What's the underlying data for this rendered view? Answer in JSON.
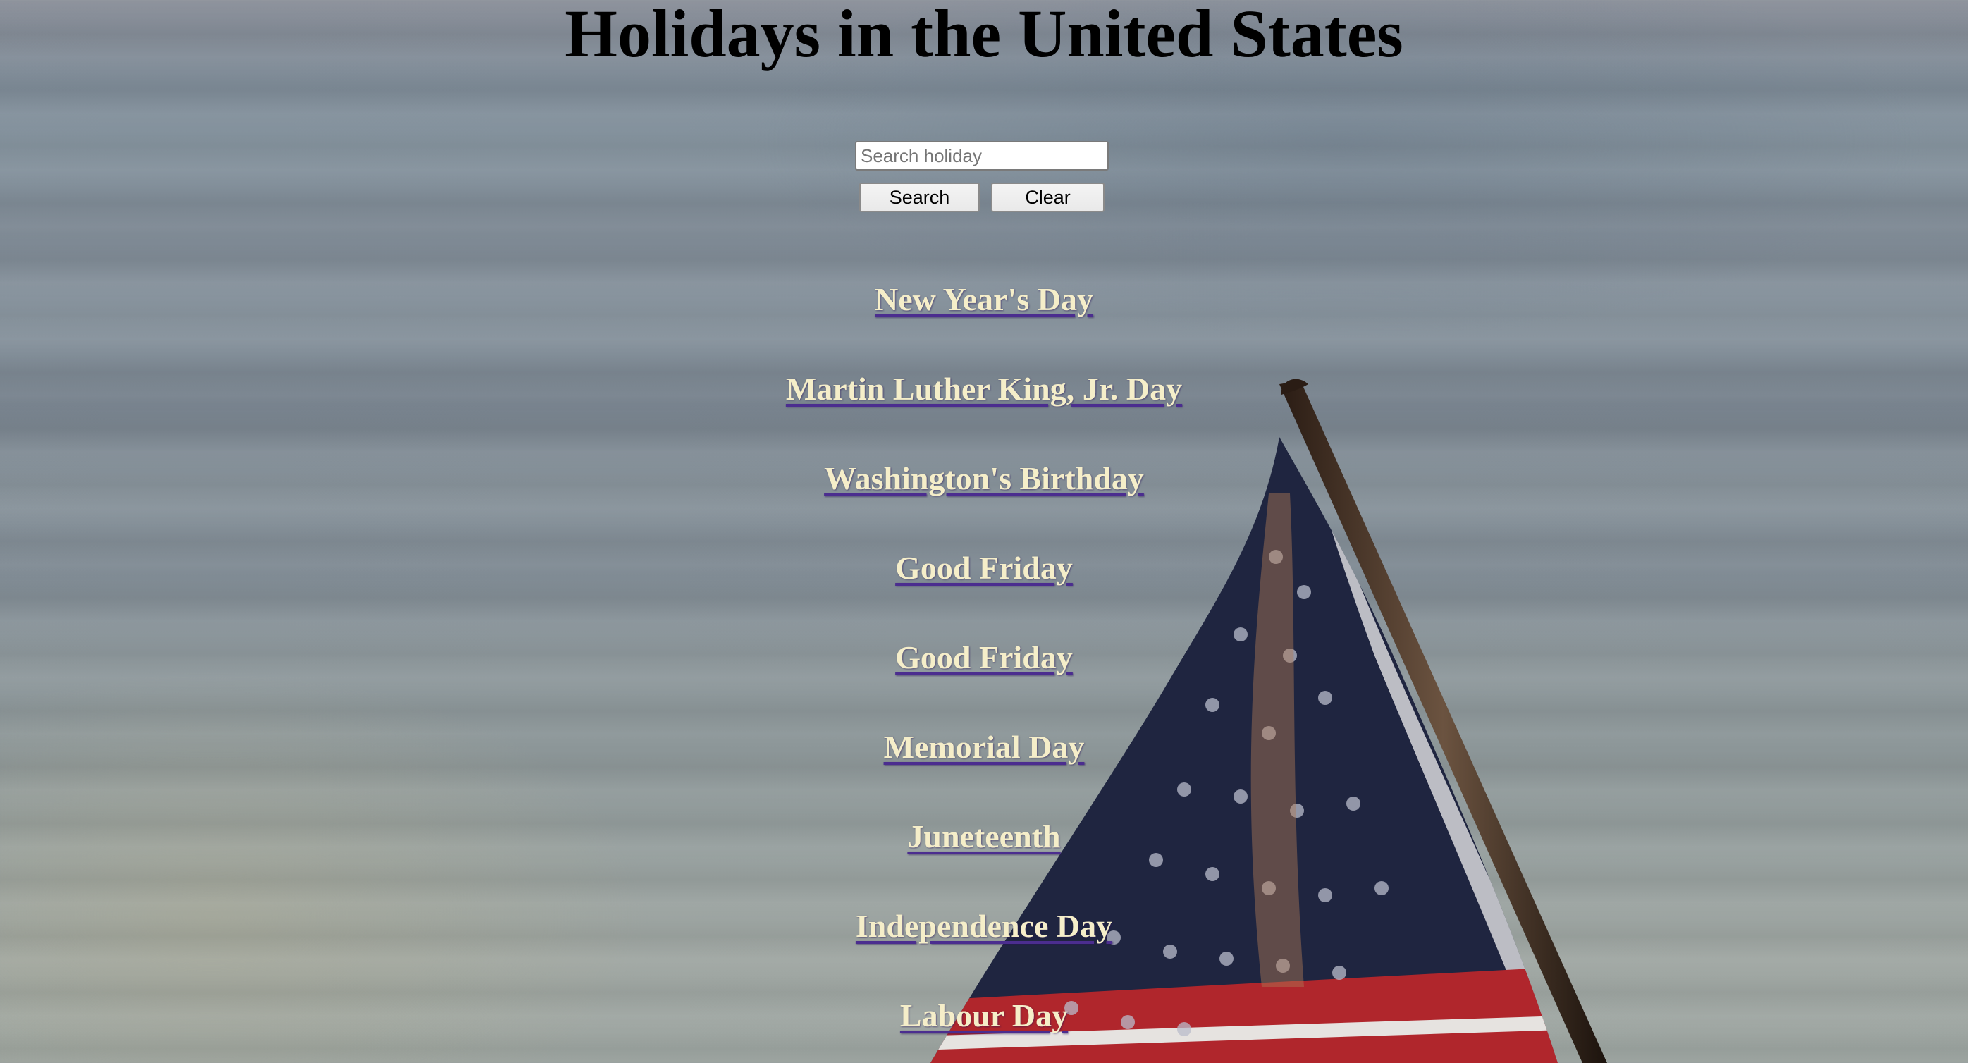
{
  "page": {
    "title": "Holidays in the United States"
  },
  "search": {
    "placeholder": "Search holiday",
    "value": "",
    "search_button_label": "Search",
    "clear_button_label": "Clear"
  },
  "holidays": [
    {
      "label": "New Year's Day"
    },
    {
      "label": "Martin Luther King, Jr. Day"
    },
    {
      "label": "Washington's Birthday"
    },
    {
      "label": "Good Friday"
    },
    {
      "label": "Good Friday"
    },
    {
      "label": "Memorial Day"
    },
    {
      "label": "Juneteenth"
    },
    {
      "label": "Independence Day"
    },
    {
      "label": "Labour Day"
    }
  ],
  "colors": {
    "link_text": "#f5eec9",
    "link_underline": "#4b2d8f",
    "title_text": "#000000"
  },
  "background": {
    "image_subject": "american-flag-on-pole"
  }
}
